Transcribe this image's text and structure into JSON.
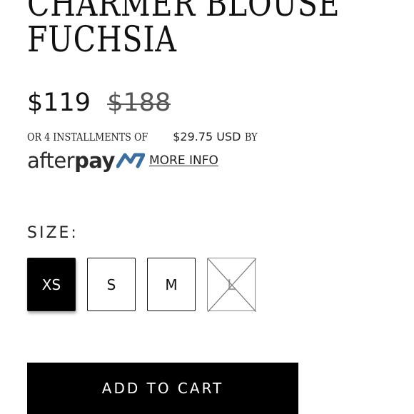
{
  "product": {
    "title_line_1": "CHARMER BLOUSE",
    "title_line_2": "FUCHSIA"
  },
  "pricing": {
    "current": "$119",
    "compare_at": "$188"
  },
  "installments": {
    "prefix": "OR 4 INSTALLMENTS OF",
    "amount": "$29.75 USD",
    "suffix": "BY"
  },
  "afterpay": {
    "logo_text_light": "after",
    "logo_text_bold": "pay",
    "more_info_label": "MORE INFO",
    "icon": "afterpay-logo-mark"
  },
  "size": {
    "label": "SIZE:",
    "options": [
      {
        "label": "XS",
        "state": "selected"
      },
      {
        "label": "S",
        "state": "available"
      },
      {
        "label": "M",
        "state": "available"
      },
      {
        "label": "L",
        "state": "unavailable"
      }
    ]
  },
  "cart": {
    "add_label": "ADD TO CART"
  },
  "colors": {
    "primary": "#000000",
    "background": "#ffffff",
    "afterpay_mark": "#3a6fa0",
    "muted": "#888888"
  }
}
